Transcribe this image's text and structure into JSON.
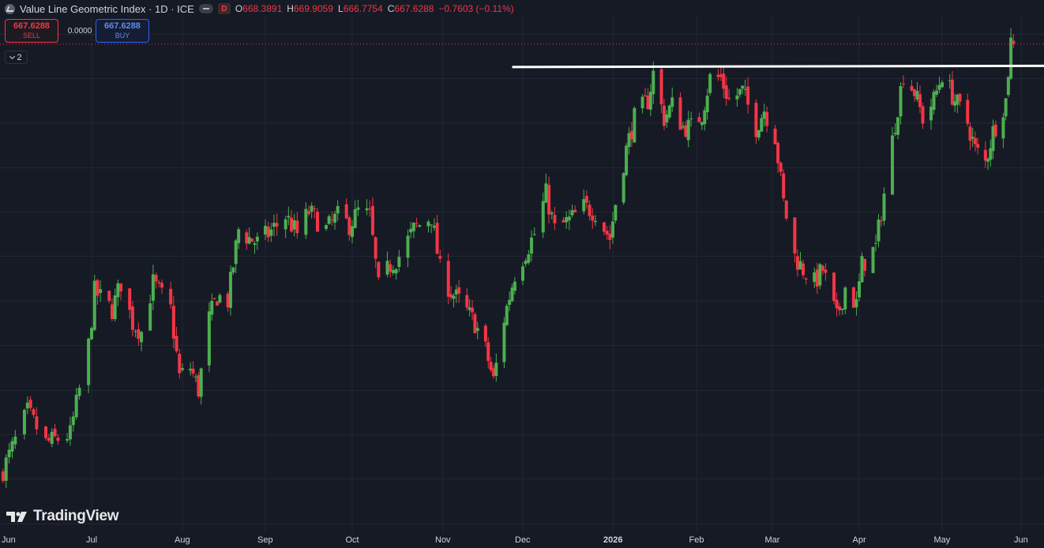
{
  "header": {
    "symbol_title": "Value Line Geometric Index · 1D · ICE",
    "interval_badge": "D",
    "ohlc": {
      "open_label": "O",
      "open": "668.3891",
      "high_label": "H",
      "high": "669.9059",
      "low_label": "L",
      "low": "666.7754",
      "close_label": "C",
      "close": "667.6288",
      "change": "−0.7603 (−0.11%)"
    }
  },
  "trade": {
    "sell_price": "667.6288",
    "sell_label": "SELL",
    "spread": "0.0000",
    "buy_price": "667.6288",
    "buy_label": "BUY"
  },
  "indicators_toggle": {
    "count": "2"
  },
  "brand": {
    "name": "TradingView"
  },
  "colors": {
    "background": "#161a25",
    "grid": "#232733",
    "up": "#4caf50",
    "down": "#f23645",
    "resistance_line": "#ffffff",
    "price_line": "#f23645"
  },
  "chart_data": {
    "type": "candlestick",
    "title": "Value Line Geometric Index",
    "interval": "1D",
    "exchange": "ICE",
    "x_tick_labels": [
      "Jun",
      "Jul",
      "Aug",
      "Sep",
      "Oct",
      "Nov",
      "Dec",
      "2026",
      "Feb",
      "Mar",
      "Apr",
      "May",
      "Jun"
    ],
    "ylim": [
      558,
      674
    ],
    "grid": true,
    "last_price": 667.6288,
    "resistance_level": 662.5,
    "series": [
      {
        "name": "Value Line Geometric Index",
        "anchors": [
          [
            "2025-06-02",
            572
          ],
          [
            "2025-06-10",
            585
          ],
          [
            "2025-06-16",
            578
          ],
          [
            "2025-06-24",
            580
          ],
          [
            "2025-06-30",
            600
          ],
          [
            "2025-07-02",
            612
          ],
          [
            "2025-07-08",
            608
          ],
          [
            "2025-07-11",
            614
          ],
          [
            "2025-07-15",
            605
          ],
          [
            "2025-07-18",
            603
          ],
          [
            "2025-07-22",
            614
          ],
          [
            "2025-07-28",
            608
          ],
          [
            "2025-07-31",
            593
          ],
          [
            "2025-08-04",
            595
          ],
          [
            "2025-08-07",
            590
          ],
          [
            "2025-08-11",
            606
          ],
          [
            "2025-08-14",
            611
          ],
          [
            "2025-08-18",
            610
          ],
          [
            "2025-08-22",
            626
          ],
          [
            "2025-08-26",
            624
          ],
          [
            "2025-08-29",
            623
          ],
          [
            "2025-09-02",
            625
          ],
          [
            "2025-09-08",
            629
          ],
          [
            "2025-09-12",
            625
          ],
          [
            "2025-09-16",
            630
          ],
          [
            "2025-09-22",
            626
          ],
          [
            "2025-09-26",
            629
          ],
          [
            "2025-09-30",
            627
          ],
          [
            "2025-10-03",
            630
          ],
          [
            "2025-10-07",
            629
          ],
          [
            "2025-10-10",
            613
          ],
          [
            "2025-10-14",
            618
          ],
          [
            "2025-10-17",
            620
          ],
          [
            "2025-10-22",
            626
          ],
          [
            "2025-10-28",
            629
          ],
          [
            "2025-10-31",
            617
          ],
          [
            "2025-11-04",
            612
          ],
          [
            "2025-11-07",
            610
          ],
          [
            "2025-11-13",
            605
          ],
          [
            "2025-11-17",
            599
          ],
          [
            "2025-11-20",
            592
          ],
          [
            "2025-11-24",
            606
          ],
          [
            "2025-11-28",
            616
          ],
          [
            "2025-12-02",
            621
          ],
          [
            "2025-12-05",
            625
          ],
          [
            "2025-12-09",
            634
          ],
          [
            "2025-12-12",
            626
          ],
          [
            "2025-12-17",
            628
          ],
          [
            "2025-12-22",
            631
          ],
          [
            "2025-12-26",
            630
          ],
          [
            "2025-12-31",
            624
          ],
          [
            "2026-01-02",
            632
          ],
          [
            "2026-01-06",
            644
          ],
          [
            "2026-01-09",
            651
          ],
          [
            "2026-01-14",
            655
          ],
          [
            "2026-01-16",
            661
          ],
          [
            "2026-01-20",
            651
          ],
          [
            "2026-01-23",
            654
          ],
          [
            "2026-01-27",
            649
          ],
          [
            "2026-01-30",
            649
          ],
          [
            "2026-02-03",
            652
          ],
          [
            "2026-02-06",
            660
          ],
          [
            "2026-02-10",
            660
          ],
          [
            "2026-02-13",
            655
          ],
          [
            "2026-02-18",
            657
          ],
          [
            "2026-02-23",
            649
          ],
          [
            "2026-02-26",
            653
          ],
          [
            "2026-03-02",
            647
          ],
          [
            "2026-03-05",
            632
          ],
          [
            "2026-03-09",
            620
          ],
          [
            "2026-03-12",
            617
          ],
          [
            "2026-03-16",
            614
          ],
          [
            "2026-03-19",
            617
          ],
          [
            "2026-03-24",
            606
          ],
          [
            "2026-03-27",
            613
          ],
          [
            "2026-03-31",
            609
          ],
          [
            "2026-04-02",
            618
          ],
          [
            "2026-04-07",
            622
          ],
          [
            "2026-04-10",
            634
          ],
          [
            "2026-04-14",
            650
          ],
          [
            "2026-04-17",
            661
          ],
          [
            "2026-04-21",
            657
          ],
          [
            "2026-04-24",
            651
          ],
          [
            "2026-04-28",
            655
          ],
          [
            "2026-05-01",
            661
          ],
          [
            "2026-05-06",
            655
          ],
          [
            "2026-05-11",
            650
          ],
          [
            "2026-05-14",
            644
          ],
          [
            "2026-05-18",
            641
          ],
          [
            "2026-05-21",
            648
          ],
          [
            "2026-05-26",
            655
          ],
          [
            "2026-05-28",
            668.39
          ],
          [
            "2026-05-29",
            667.63
          ]
        ]
      }
    ]
  }
}
